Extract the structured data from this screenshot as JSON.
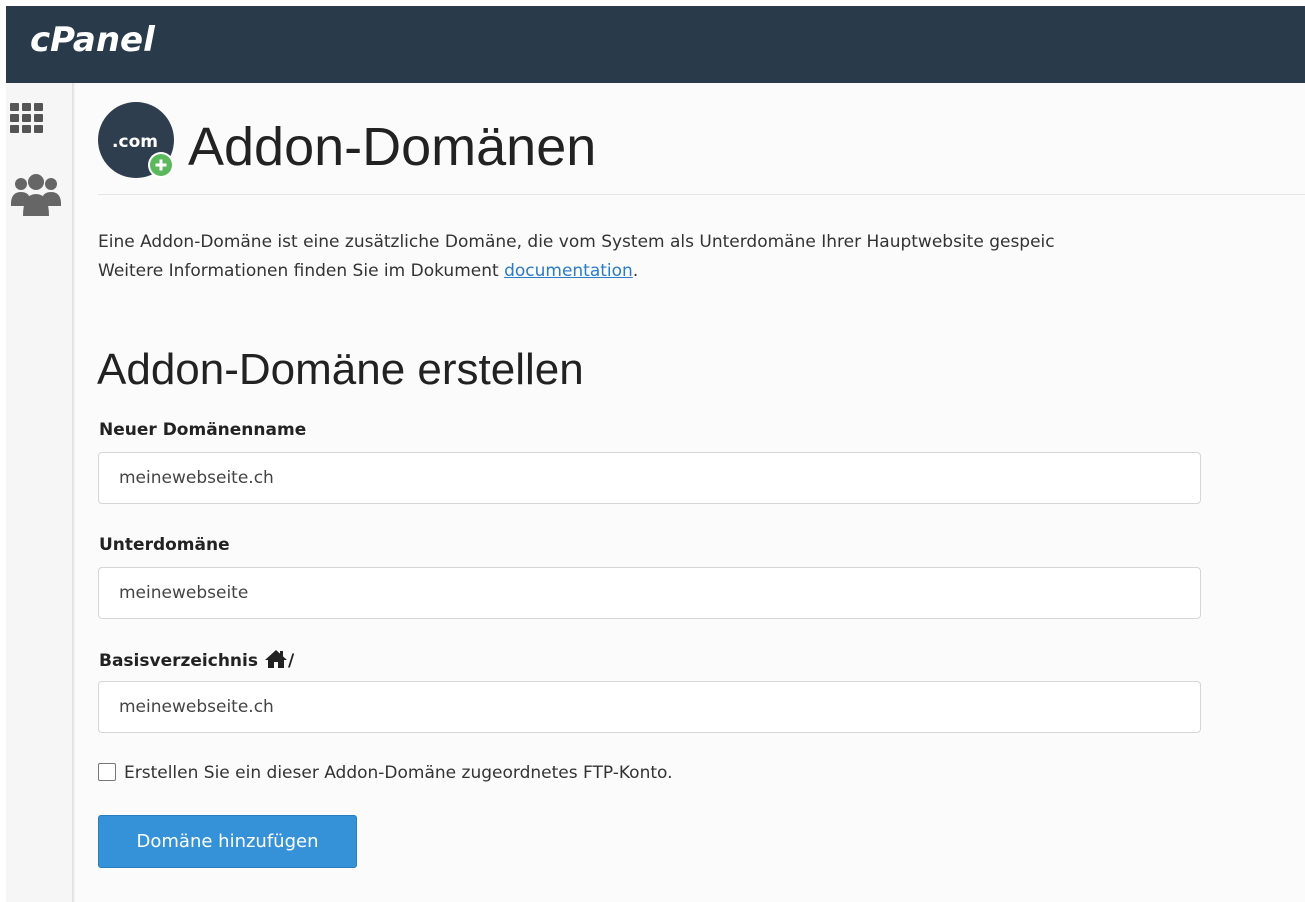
{
  "header": {
    "logo_text": "cPanel"
  },
  "sidebar": {
    "items": [
      {
        "icon": "grid-icon",
        "label": ""
      },
      {
        "icon": "users-icon",
        "label": ""
      }
    ]
  },
  "page": {
    "icon_text": ".com",
    "title": "Addon-Domänen",
    "description_line1": "Eine Addon-Domäne ist eine zusätzliche Domäne, die vom System als Unterdomäne Ihrer Hauptwebsite gespeic",
    "description_line2_prefix": "Weitere Informationen finden Sie im Dokument ",
    "documentation_link": "documentation",
    "description_line2_suffix": "."
  },
  "form": {
    "section_title": "Addon-Domäne erstellen",
    "new_domain_label": "Neuer Domänenname",
    "new_domain_value": "meinewebseite.ch",
    "subdomain_label": "Unterdomäne",
    "subdomain_value": "meinewebseite",
    "docroot_label": "Basisverzeichnis",
    "docroot_suffix": "/",
    "docroot_value": "meinewebseite.ch",
    "ftp_checkbox_label": "Erstellen Sie ein dieser Addon-Domäne zugeordnetes FTP-Konto.",
    "ftp_checked": false,
    "submit_label": "Domäne hinzufügen"
  },
  "colors": {
    "topbar": "#293a4a",
    "primary_button": "#3592d8",
    "link": "#2a7bc8",
    "badge_plus": "#5cb85c"
  }
}
